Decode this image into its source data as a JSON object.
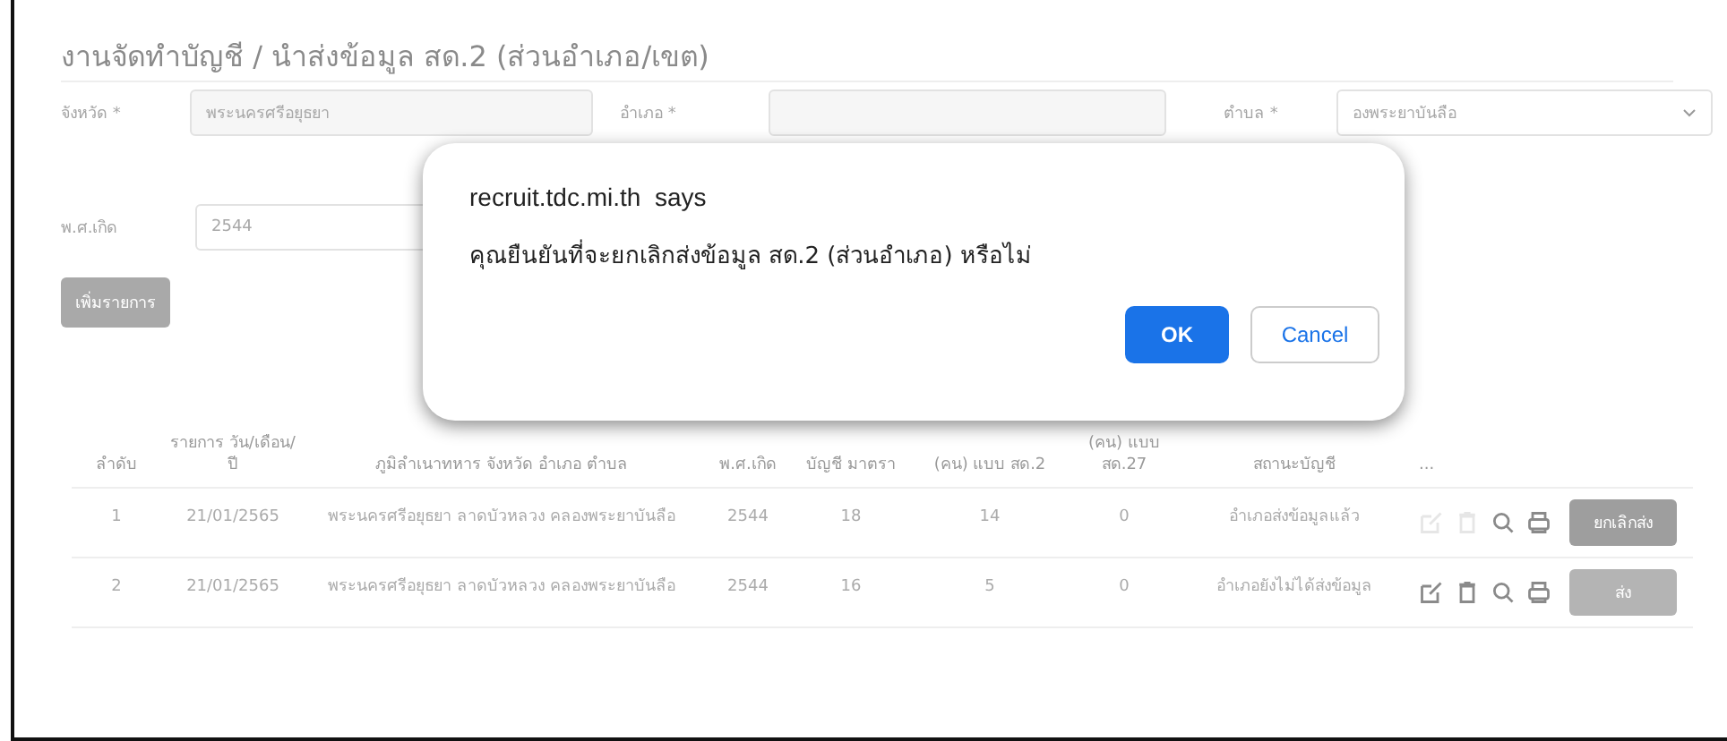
{
  "page_title": "งานจัดทำบัญชี / นำส่งข้อมูล สด.2 (ส่วนอำเภอ/เขต)",
  "filters": [
    {
      "label": "จังหวัด *",
      "value": "พระนครศรีอยุธยา",
      "kind": "text"
    },
    {
      "label": "อำเภอ *",
      "kind": "text"
    },
    {
      "label": "ตำบล *",
      "value": "องพระยาบันลือ",
      "kind": "select"
    }
  ],
  "birth_year": {
    "label": "พ.ศ.เกิด",
    "value": "2544"
  },
  "add_button": "เพิ่มรายการ",
  "table": {
    "columns": [
      "ลำดับ",
      "รายการ วัน/เดือน/ ปี",
      "ภูมิลำเนาทหาร จังหวัด อำเภอ ตำบล",
      "พ.ศ.เกิด",
      "บัญชี มาตรา",
      "(คน) แบบ สด.2",
      "(คน) แบบ สด.27",
      "สถานะบัญชี",
      "..."
    ],
    "rows": [
      {
        "cells": [
          "1",
          "21/01/2565",
          "พระนครศรีอยุธยา ลาดบัวหลวง คลองพระยาบันลือ",
          "2544",
          "18",
          "14",
          "0",
          "อำเภอส่งข้อมูลแล้ว"
        ],
        "edit_disabled": true,
        "action": "ยกเลิกส่ง",
        "kind": "cancel"
      },
      {
        "cells": [
          "2",
          "21/01/2565",
          "พระนครศรีอยุธยา ลาดบัวหลวง คลองพระยาบันลือ",
          "2544",
          "16",
          "5",
          "0",
          "อำเภอยังไม่ได้ส่งข้อมูล"
        ],
        "edit_disabled": false,
        "action": "ส่ง",
        "kind": "send"
      }
    ]
  },
  "dialog": {
    "title": "recruit.tdc.mi.th  says",
    "message": "คุณยืนยันที่จะยกเลิกส่งข้อมูล สด.2 (ส่วนอำเภอ) หรือไม่",
    "buttons": [
      {
        "label": "OK",
        "kind": "primary"
      },
      {
        "label": "Cancel",
        "kind": "secondary"
      }
    ]
  }
}
